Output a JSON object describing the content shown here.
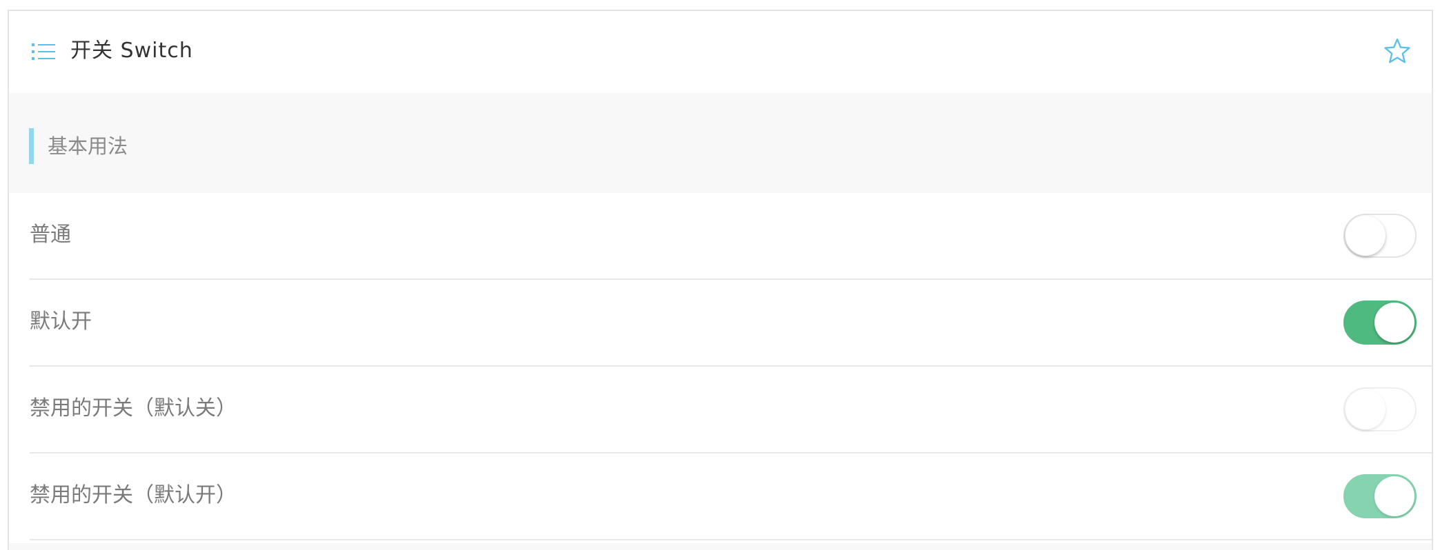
{
  "header": {
    "title": "开关  Switch",
    "menu_icon": "list-menu-icon",
    "star_icon": "star-outline-icon",
    "accent_color": "#5bc0ea"
  },
  "section": {
    "title": "基本用法",
    "bar_color": "#93d7ef"
  },
  "rows": [
    {
      "label": "普通",
      "checked": false,
      "disabled": false
    },
    {
      "label": "默认开",
      "checked": true,
      "disabled": false
    },
    {
      "label": "禁用的开关（默认关）",
      "checked": false,
      "disabled": true
    },
    {
      "label": "禁用的开关（默认开）",
      "checked": true,
      "disabled": true
    }
  ],
  "colors": {
    "switch_on": "#4fba80",
    "switch_on_disabled": "#85d3af",
    "switch_off_border": "#e3e3e3",
    "label_text": "#7a7a7a"
  }
}
